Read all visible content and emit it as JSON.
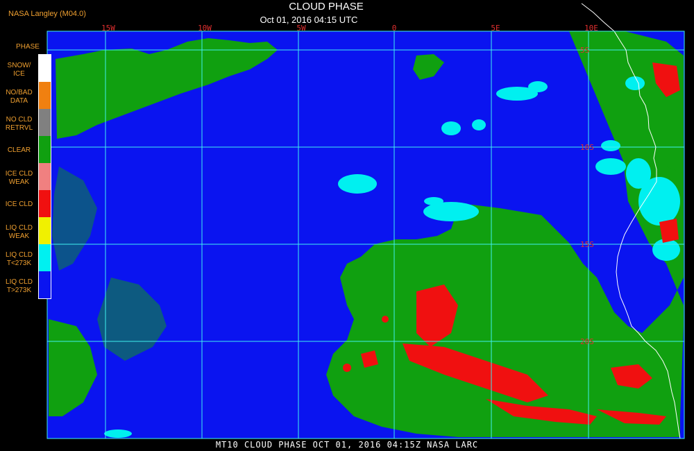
{
  "header": {
    "credit": "NASA Langley (M04.0)",
    "title": "CLOUD PHASE",
    "datetime": "Oct 01, 2016 04:15 UTC"
  },
  "footer": {
    "caption": "MT10   CLOUD PHASE   OCT 01, 2016 04:15Z   NASA LARC"
  },
  "map": {
    "longitude_labels": [
      "15W",
      "10W",
      "5W",
      "0",
      "5E",
      "10E"
    ],
    "latitude_labels": [
      "5S",
      "10S",
      "15S",
      "20S"
    ],
    "colors": {
      "liq_warm": "#0a14f0",
      "clear": "#10a010",
      "liq_cold": "#00f0f0",
      "ice": "#f01010",
      "grid": "#40f0f0",
      "coast": "#ffffff"
    }
  },
  "legend": {
    "title": "PHASE",
    "items": [
      {
        "label": "SNOW/\nICE",
        "color": "#ffffff"
      },
      {
        "label": "NO/BAD\nDATA",
        "color": "#f08010"
      },
      {
        "label": "NO CLD\nRETRVL",
        "color": "#808080"
      },
      {
        "label": "CLEAR",
        "color": "#10a010"
      },
      {
        "label": "ICE CLD\nWEAK",
        "color": "#f08080"
      },
      {
        "label": "ICE CLD",
        "color": "#f01010"
      },
      {
        "label": "LIQ CLD\nWEAK",
        "color": "#f0f000"
      },
      {
        "label": "LIQ CLD\nT<273K",
        "color": "#00f0f0"
      },
      {
        "label": "LIQ CLD\nT>273K",
        "color": "#0a14f0"
      }
    ]
  }
}
